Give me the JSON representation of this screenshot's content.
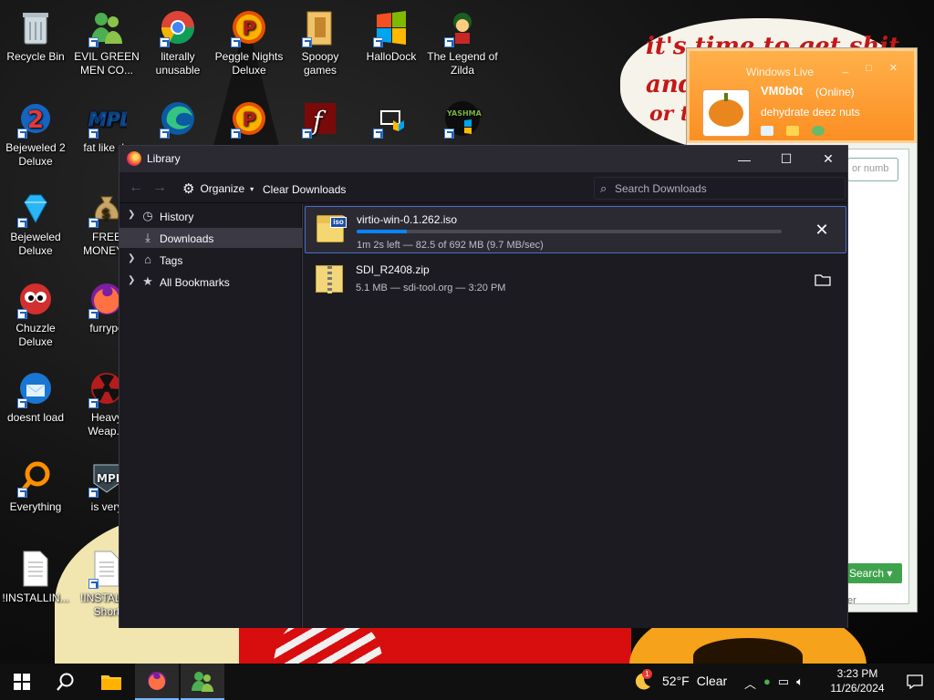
{
  "desktop": {
    "wallpaper_text": [
      "it's time to get shit",
      "and",
      "or t"
    ],
    "icons": [
      {
        "label": "Recycle Bin",
        "icon": "recycle-bin-icon"
      },
      {
        "label": "EVIL GREEN MEN CO...",
        "icon": "messenger-people-icon"
      },
      {
        "label": "literally unusable",
        "icon": "chrome-icon"
      },
      {
        "label": "Peggle Nights Deluxe",
        "icon": "peggle-icon"
      },
      {
        "label": "Spoopy games",
        "icon": "folder-icon"
      },
      {
        "label": "HalloDock",
        "icon": "windows-logo-icon"
      },
      {
        "label": "The Legend of Zilda",
        "icon": "game-character-icon"
      },
      {
        "label": "Bejeweled 2 Deluxe",
        "icon": "bejeweled2-icon"
      },
      {
        "label": "fat like da",
        "icon": "mpl-icon"
      },
      {
        "label": "",
        "icon": "edge-icon"
      },
      {
        "label": "",
        "icon": "peggle-icon"
      },
      {
        "label": "",
        "icon": "flash-icon"
      },
      {
        "label": "",
        "icon": "admin-monitor-icon"
      },
      {
        "label": "",
        "icon": "yashma-icon"
      },
      {
        "label": "Bejeweled Deluxe",
        "icon": "gem-icon"
      },
      {
        "label": "FREE MONEY.c",
        "icon": "money-bag-icon"
      },
      {
        "label": "Chuzzle Deluxe",
        "icon": "chuzzle-icon"
      },
      {
        "label": "furrypo",
        "icon": "firefox-icon"
      },
      {
        "label": "doesnt load",
        "icon": "thunderbird-icon"
      },
      {
        "label": "Heavy Weap...",
        "icon": "radiation-icon"
      },
      {
        "label": "Everything",
        "icon": "search-ring-icon"
      },
      {
        "label": "is very",
        "icon": "mpl-icon"
      },
      {
        "label": "!INSTALLIN...",
        "icon": "text-file-icon"
      },
      {
        "label": "!INSTALL - Short",
        "icon": "text-file-icon"
      }
    ]
  },
  "messenger": {
    "title": "Windows Live",
    "username": "VM0b0t",
    "status": "(Online)",
    "personal_message": "dehydrate deez nuts",
    "search_placeholder": "or numb",
    "search_button": "Search",
    "footer": "er"
  },
  "library": {
    "title": "Library",
    "toolbar": {
      "organize": "Organize",
      "clear_downloads": "Clear Downloads",
      "search_placeholder": "Search Downloads"
    },
    "sidebar": [
      {
        "label": "History",
        "icon": "clock-icon",
        "expandable": true,
        "selected": false
      },
      {
        "label": "Downloads",
        "icon": "download-icon",
        "expandable": false,
        "selected": true
      },
      {
        "label": "Tags",
        "icon": "tag-icon",
        "expandable": true,
        "selected": false
      },
      {
        "label": "All Bookmarks",
        "icon": "star-icon",
        "expandable": true,
        "selected": false
      }
    ],
    "downloads": [
      {
        "name": "virtio-win-0.1.262.iso",
        "status": "1m 2s left — 82.5 of 692 MB (9.7 MB/sec)",
        "progress": 0.119,
        "file_icon": "iso-file-icon",
        "file_badge": "iso",
        "action_icon": "close-icon",
        "in_progress": true
      },
      {
        "name": "SDI_R2408.zip",
        "status": "5.1 MB — sdi-tool.org — 3:20 PM",
        "file_icon": "zip-file-icon",
        "action_icon": "folder-open-icon",
        "in_progress": false
      }
    ]
  },
  "taskbar": {
    "weather_temp": "52°F",
    "weather_cond": "Clear",
    "weather_badge": "1",
    "time": "3:23 PM",
    "date": "11/26/2024"
  },
  "colors": {
    "accent": "#0a84ff",
    "window_bg": "#1c1b22",
    "titlebar_bg": "#2b2a33",
    "messenger_orange": "#fb8f23"
  }
}
